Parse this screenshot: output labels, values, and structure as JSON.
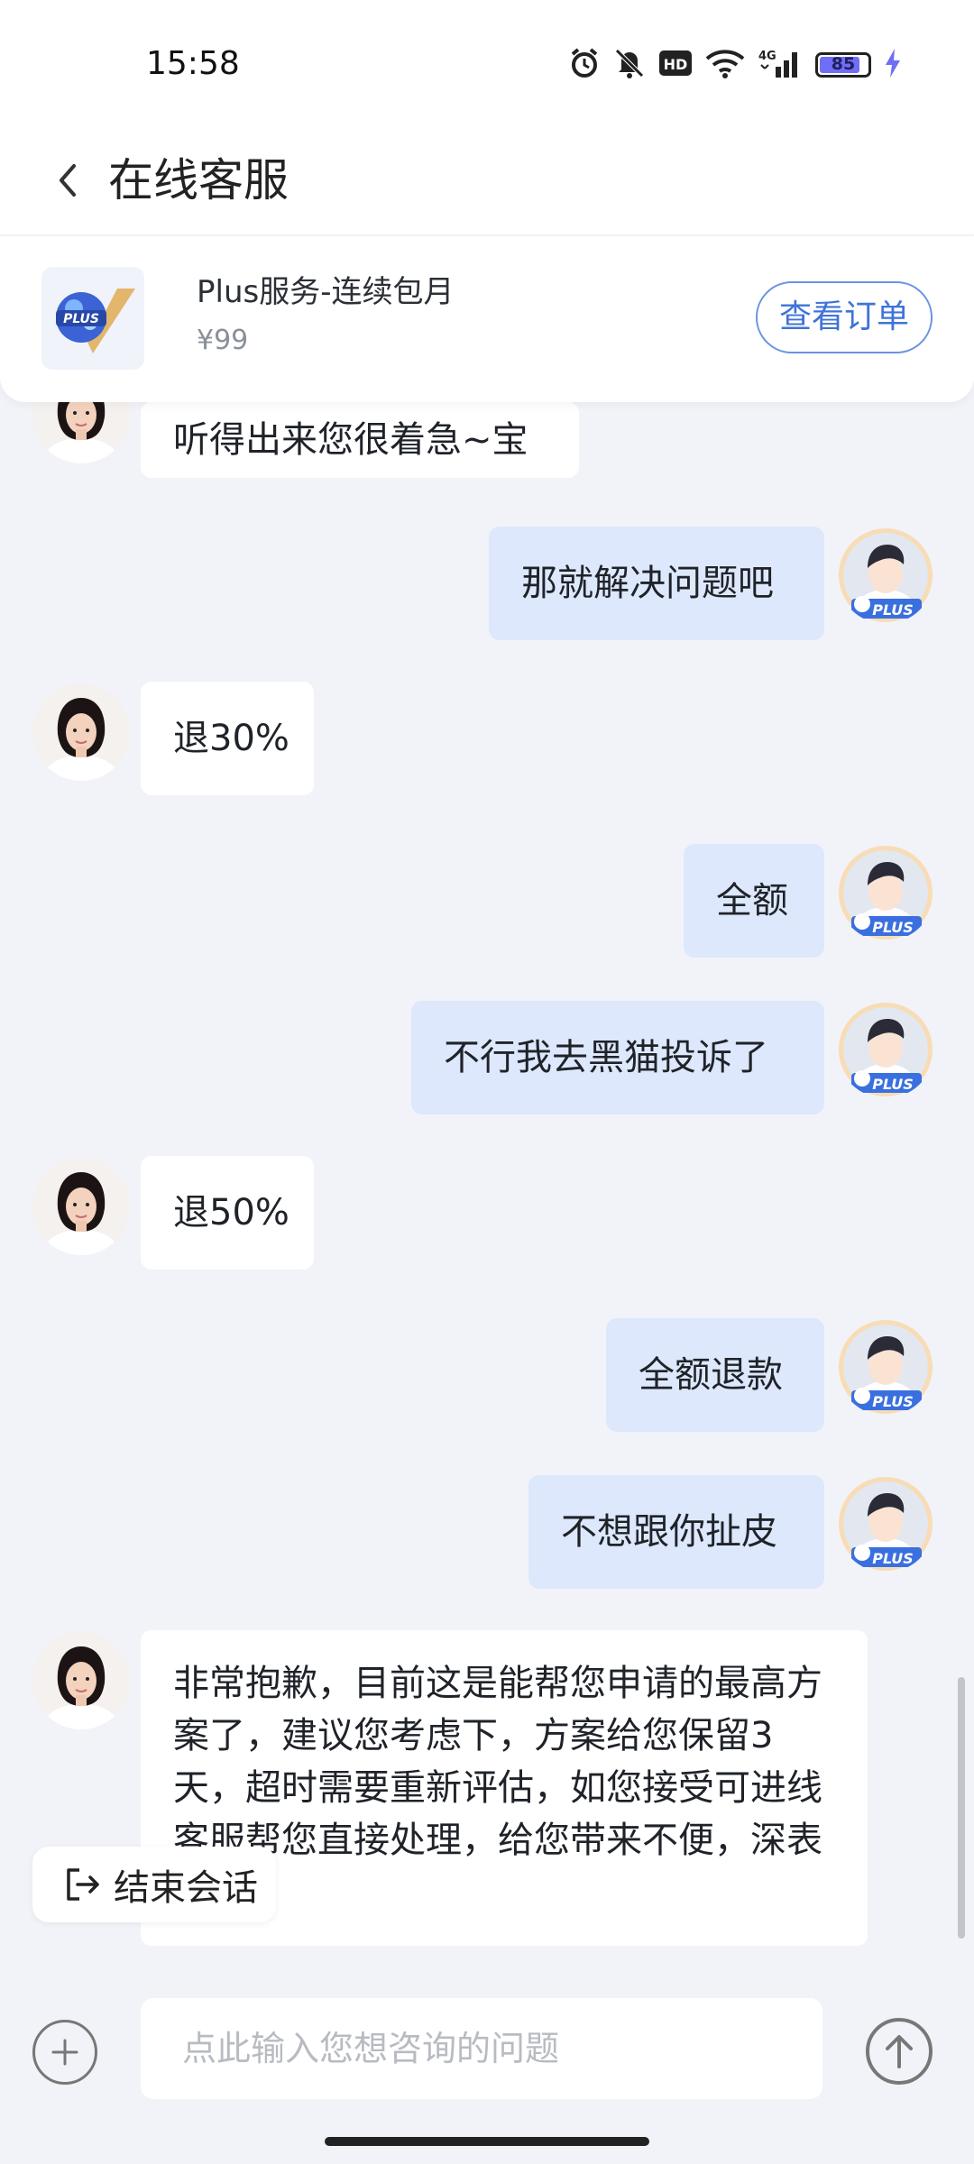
{
  "status_bar": {
    "time": "15:58",
    "battery": "85",
    "network": "4G"
  },
  "nav": {
    "title": "在线客服"
  },
  "order_card": {
    "product_name": "Plus服务-连续包月",
    "price": "¥99",
    "view_order_label": "查看订单",
    "thumb_badge": "PLUS"
  },
  "messages": [
    {
      "from": "agent",
      "text": "听得出来您很着急~宝"
    },
    {
      "from": "user",
      "text": "那就解决问题吧"
    },
    {
      "from": "agent",
      "text": "退30%"
    },
    {
      "from": "user",
      "text": "全额"
    },
    {
      "from": "user",
      "text": "不行我去黑猫投诉了"
    },
    {
      "from": "agent",
      "text": "退50%"
    },
    {
      "from": "user",
      "text": "全额退款"
    },
    {
      "from": "user",
      "text": "不想跟你扯皮"
    },
    {
      "from": "agent",
      "text": "非常抱歉，目前这是能帮您申请的最高方案了，建议您考虑下，方案给您保留3天，超时需要重新评估，如您接受可进线客服帮您直接处理，给您带来不便，深表歉意。"
    }
  ],
  "avatar_badge": "PLUS",
  "end_chat_label": "结束会话",
  "input": {
    "placeholder": "点此输入您想咨询的问题"
  },
  "colors": {
    "accent": "#3f73d9",
    "user_bubble": "#dde8fc",
    "background": "#f2f3f8"
  }
}
